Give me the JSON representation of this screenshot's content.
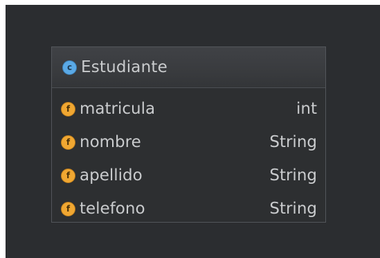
{
  "class_box": {
    "icon_letter": "c",
    "icon": "class-icon",
    "name": "Estudiante"
  },
  "fields": [
    {
      "icon_letter": "f",
      "icon": "field-icon",
      "name": "matricula",
      "type": "int"
    },
    {
      "icon_letter": "f",
      "icon": "field-icon",
      "name": "nombre",
      "type": "String"
    },
    {
      "icon_letter": "f",
      "icon": "field-icon",
      "name": "apellido",
      "type": "String"
    },
    {
      "icon_letter": "f",
      "icon": "field-icon",
      "name": "telefono",
      "type": "String"
    }
  ],
  "colors": {
    "background": "#2b2d30",
    "class_icon": "#5aa9e6",
    "field_icon": "#f0a732",
    "text": "#c9cbcd"
  }
}
